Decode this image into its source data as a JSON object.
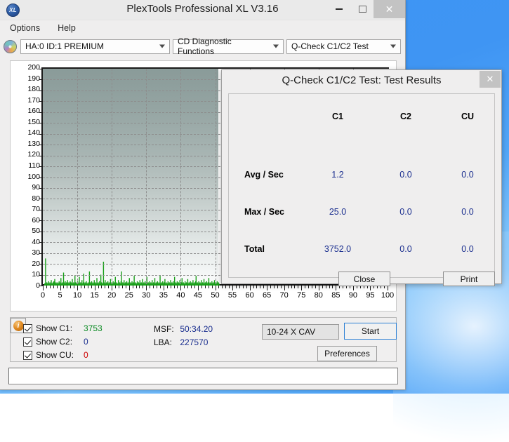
{
  "window": {
    "title": "PlexTools Professional XL V3.16",
    "logo_text": "XL",
    "minimize_label": "",
    "maximize_label": "",
    "close_label": "✕"
  },
  "menubar": {
    "items": [
      {
        "label": "Options"
      },
      {
        "label": "Help"
      }
    ]
  },
  "toolbar": {
    "drive": "HA:0 ID:1  PREMIUM",
    "function": "CD Diagnostic Functions",
    "test": "Q-Check C1/C2 Test"
  },
  "controls": {
    "checkboxes": [
      {
        "label": "Show C1:",
        "value": "3753",
        "color": "#0a8a22"
      },
      {
        "label": "Show C2:",
        "value": "0",
        "color": "#1b2f8f"
      },
      {
        "label": "Show CU:",
        "value": "0",
        "color": "#cc0000"
      }
    ],
    "msf_key": "MSF:",
    "msf_value": "50:34.20",
    "lba_key": "LBA:",
    "lba_value": "227570",
    "speed": "10-24 X CAV",
    "start_label": "Start",
    "preferences_label": "Preferences",
    "info_glyph": "i"
  },
  "dialog": {
    "title": "Q-Check C1/C2 Test: Test Results",
    "close_label": "✕",
    "columns": [
      "C1",
      "C2",
      "CU"
    ],
    "rows": [
      {
        "label": "Avg / Sec",
        "values": [
          "1.2",
          "0.0",
          "0.0"
        ]
      },
      {
        "label": "Max / Sec",
        "values": [
          "25.0",
          "0.0",
          "0.0"
        ]
      },
      {
        "label": "Total",
        "values": [
          "3752.0",
          "0.0",
          "0.0"
        ]
      }
    ],
    "close_button": "Close",
    "print_button": "Print"
  },
  "chart_data": {
    "type": "line",
    "title": "",
    "xlabel": "",
    "ylabel": "",
    "xlim": [
      0,
      100
    ],
    "ylim": [
      0,
      200
    ],
    "xticks": [
      0,
      5,
      10,
      15,
      20,
      25,
      30,
      35,
      40,
      45,
      50,
      55,
      60,
      65,
      70,
      75,
      80,
      85,
      90,
      95,
      100
    ],
    "yticks": [
      0,
      10,
      20,
      30,
      40,
      50,
      60,
      70,
      80,
      90,
      100,
      110,
      120,
      130,
      140,
      150,
      160,
      170,
      180,
      190,
      200
    ],
    "grid": true,
    "legend_position": "none",
    "series": [
      {
        "name": "C1",
        "color": "#1aa01a",
        "x_end": 50.8,
        "points": [
          0.0,
          2.0,
          1.0,
          25.0,
          1.0,
          2.0,
          3.0,
          1.0,
          2.0,
          1.0,
          4.0,
          2.0,
          1.0,
          3.0,
          2.0,
          1.0,
          5.0,
          2.0,
          1.0,
          2.0,
          3.0,
          1.0,
          4.0,
          2.0,
          6.0,
          1.0,
          2.0,
          3.0,
          1.0,
          2.0,
          1.0,
          3.0,
          2.0,
          1.0,
          4.0,
          2.0,
          1.0,
          3.0,
          7.0,
          2.0,
          1.0,
          3.0,
          2.0,
          1.0,
          12.0,
          3.0,
          2.0,
          1.0,
          4.0,
          2.0,
          1.0,
          3.0,
          2.0,
          5.0,
          1.0,
          2.0,
          3.0,
          1.0,
          2.0,
          4.0,
          1.0,
          3.0,
          2.0,
          1.0,
          6.0,
          2.0,
          1.0,
          3.0,
          2.0,
          1.0,
          9.0,
          2.0,
          3.0,
          1.0,
          2.0,
          1.0,
          4.0,
          2.0,
          1.0,
          3.0,
          8.0,
          2.0,
          1.0,
          3.0,
          2.0,
          1.0,
          5.0,
          2.0,
          1.0,
          3.0,
          11.0,
          2.0,
          1.0,
          3.0,
          2.0,
          1.0,
          4.0,
          2.0,
          1.0,
          2.0,
          3.0,
          1.0,
          2.0,
          13.0,
          1.0,
          3.0,
          2.0,
          1.0,
          4.0,
          2.0,
          1.0,
          3.0,
          2.0,
          1.0,
          5.0,
          2.0,
          1.0,
          3.0,
          2.0,
          1.0,
          7.0,
          2.0,
          1.0,
          3.0,
          2.0,
          1.0,
          4.0,
          2.0,
          1.0,
          10.0,
          2.0,
          3.0,
          1.0,
          2.0,
          1.0,
          22.0,
          3.0,
          2.0,
          1.0,
          5.0,
          2.0,
          1.0,
          3.0,
          2.0,
          1.0,
          4.0,
          2.0,
          1.0,
          3.0,
          2.0,
          1.0,
          6.0,
          2.0,
          1.0,
          3.0,
          2.0,
          1.0,
          4.0,
          2.0,
          1.0,
          3.0,
          2.0,
          8.0,
          1.0,
          2.0,
          3.0,
          1.0,
          2.0,
          1.0,
          5.0,
          2.0,
          1.0,
          3.0,
          2.0,
          1.0,
          4.0,
          13.0,
          2.0,
          1.0,
          3.0,
          2.0,
          1.0,
          5.0,
          2.0,
          1.0,
          3.0,
          2.0,
          1.0,
          4.0,
          2.0,
          1.0,
          3.0,
          2.0,
          1.0,
          7.0,
          2.0,
          1.0,
          3.0,
          2.0,
          1.0,
          4.0,
          2.0,
          1.0,
          3.0,
          2.0,
          9.0,
          1.0,
          2.0,
          3.0,
          1.0,
          2.0,
          1.0,
          4.0,
          2.0,
          1.0,
          3.0,
          2.0,
          1.0,
          5.0,
          2.0,
          1.0,
          3.0,
          2.0,
          1.0,
          6.0,
          2.0,
          1.0,
          3.0,
          2.0,
          1.0,
          4.0,
          2.0,
          1.0,
          3.0,
          8.0,
          2.0,
          1.0,
          3.0,
          2.0,
          1.0,
          4.0,
          2.0,
          1.0,
          3.0,
          2.0,
          1.0,
          5.0,
          2.0,
          1.0,
          3.0,
          2.0,
          1.0,
          7.0,
          2.0,
          1.0,
          3.0,
          2.0,
          1.0,
          4.0,
          2.0,
          1.0,
          3.0,
          2.0,
          1.0,
          9.0,
          2.0,
          1.0,
          3.0,
          2.0,
          1.0,
          4.0,
          2.0,
          1.0,
          3.0,
          2.0,
          6.0,
          1.0,
          2.0,
          3.0,
          1.0,
          2.0,
          1.0,
          4.0,
          2.0,
          1.0,
          3.0,
          2.0,
          1.0,
          5.0,
          2.0,
          1.0,
          3.0,
          2.0,
          1.0,
          4.0,
          2.0,
          1.0,
          8.0,
          2.0,
          1.0,
          3.0,
          2.0,
          1.0,
          4.0,
          2.0,
          1.0,
          3.0,
          2.0,
          1.0,
          5.0,
          2.0,
          1.0,
          3.0,
          2.0,
          7.0,
          1.0,
          2.0,
          3.0,
          1.0,
          2.0,
          1.0,
          4.0,
          2.0,
          1.0,
          3.0,
          2.0,
          1.0,
          6.0,
          2.0,
          1.0,
          3.0,
          2.0,
          1.0,
          4.0,
          2.0,
          1.0,
          3.0,
          2.0,
          1.0,
          5.0,
          2.0,
          1.0,
          3.0,
          2.0,
          1.0,
          4.0,
          9.0,
          2.0,
          1.0,
          3.0,
          2.0,
          1.0,
          4.0,
          2.0,
          1.0,
          3.0,
          2.0,
          1.0,
          5.0,
          2.0,
          1.0,
          3.0,
          2.0,
          1.0,
          6.0,
          2.0,
          1.0,
          3.0,
          2.0,
          1.0,
          4.0,
          2.0,
          1.0,
          3.0,
          2.0,
          7.0,
          1.0,
          2.0,
          3.0,
          1.0,
          2.0,
          1.0,
          4.0,
          2.0,
          1.0,
          3.0,
          2.0,
          1.0,
          5.0,
          2.0,
          1.0,
          3.0,
          2.0,
          1.0,
          4.0,
          2.0,
          1.0,
          3.0,
          2.0,
          1.0
        ]
      }
    ]
  }
}
